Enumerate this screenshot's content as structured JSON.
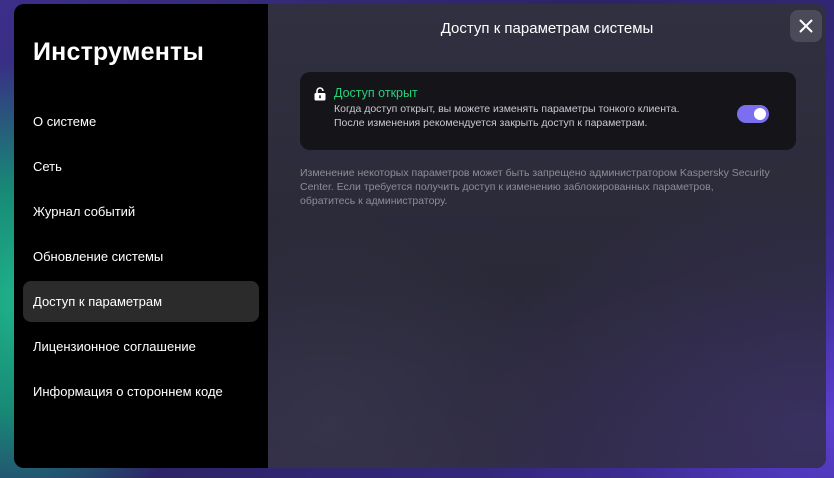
{
  "sidebar": {
    "title": "Инструменты",
    "items": [
      {
        "label": "О системе"
      },
      {
        "label": "Сеть"
      },
      {
        "label": "Журнал событий"
      },
      {
        "label": "Обновление системы"
      },
      {
        "label": "Доступ к параметрам",
        "active": true
      },
      {
        "label": "Лицензионное соглашение"
      },
      {
        "label": "Информация о стороннем коде"
      }
    ]
  },
  "header": {
    "title": "Доступ к параметрам системы",
    "close_icon": "close-icon"
  },
  "access_card": {
    "icon": "unlock-icon",
    "status_title": "Доступ открыт",
    "description_line1": "Когда доступ открыт, вы можете изменять параметры тонкого клиента.",
    "description_line2": "После изменения рекомендуется закрыть доступ к параметрам.",
    "toggle_on": true
  },
  "note": {
    "text": "Изменение некоторых параметров может быть запрещено администратором Kaspersky Security Center. Если требуется получить доступ к изменению заблокированных параметров, обратитесь к администратору."
  },
  "colors": {
    "accent_toggle": "#7b6ff0",
    "status_green": "#27d07a"
  }
}
